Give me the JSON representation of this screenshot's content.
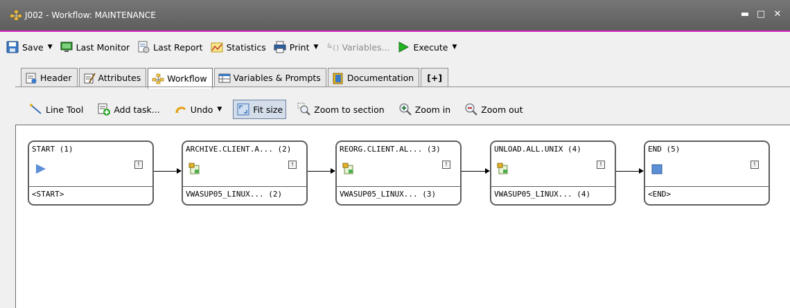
{
  "window": {
    "title": "J002 - Workflow: MAINTENANCE",
    "minimize_glyph": "▬",
    "maximize_glyph": "□",
    "close_glyph": "✕"
  },
  "toolbar": {
    "save": "Save",
    "last_monitor": "Last Monitor",
    "last_report": "Last Report",
    "statistics": "Statistics",
    "print": "Print",
    "variables": "Variables...",
    "execute": "Execute"
  },
  "tabs": [
    {
      "label": "Header"
    },
    {
      "label": "Attributes"
    },
    {
      "label": "Workflow"
    },
    {
      "label": "Variables & Prompts"
    },
    {
      "label": "Documentation"
    },
    {
      "label": "[+]"
    }
  ],
  "subbar": {
    "line_tool": "Line Tool",
    "add_task": "Add task...",
    "undo": "Undo",
    "fit_size": "Fit size",
    "zoom_section": "Zoom to section",
    "zoom_in": "Zoom in",
    "zoom_out": "Zoom out"
  },
  "nodes": [
    {
      "title": "START (1)",
      "footer": "<START>",
      "icon": "play-triangle-icon"
    },
    {
      "title": "ARCHIVE.CLIENT.A... (2)",
      "footer": "VWASUP05_LINUX... (2)",
      "icon": "job-icon"
    },
    {
      "title": "REORG.CLIENT.AL... (3)",
      "footer": "VWASUP05_LINUX... (3)",
      "icon": "job-icon"
    },
    {
      "title": "UNLOAD.ALL.UNIX (4)",
      "footer": "VWASUP05_LINUX... (4)",
      "icon": "job-icon"
    },
    {
      "title": "END (5)",
      "footer": "<END>",
      "icon": "end-square-icon"
    }
  ],
  "colors": {
    "titlebar": "#6a6a6a",
    "accent": "#d81ec0",
    "execute_green": "#22b222",
    "active_tab_bg": "#ffffff"
  }
}
